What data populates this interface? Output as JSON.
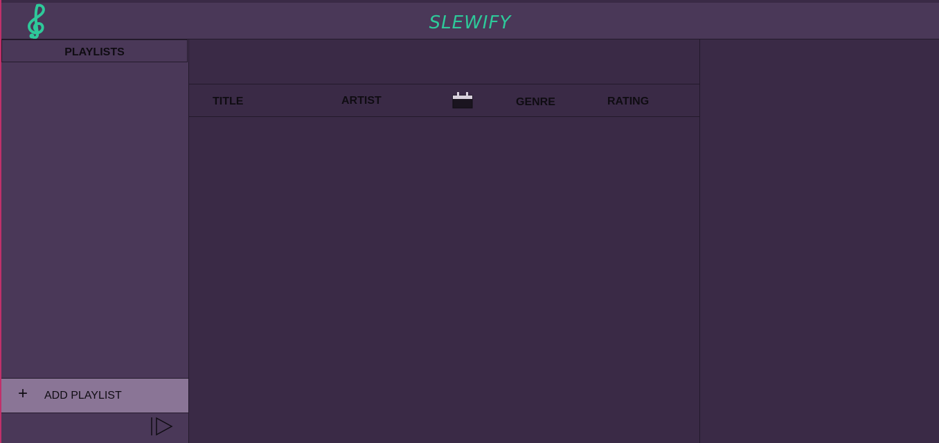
{
  "header": {
    "app_title": "SLEWIFY",
    "logo_icon": "treble-clef-icon",
    "accent_color": "#2ec99a"
  },
  "sidebar": {
    "title": "PLAYLISTS",
    "playlists": [],
    "add_playlist_label": "ADD PLAYLIST",
    "add_icon": "+",
    "play_icon": "play-icon"
  },
  "table": {
    "columns": {
      "title": "TITLE",
      "artist": "ARTIST",
      "date_icon": "calendar-icon",
      "genre": "GENRE",
      "rating": "RATING"
    },
    "rows": []
  },
  "colors": {
    "background": "#3a2a46",
    "panel": "#4a3858",
    "button": "#8a7596",
    "border_accent": "#c0306a"
  }
}
